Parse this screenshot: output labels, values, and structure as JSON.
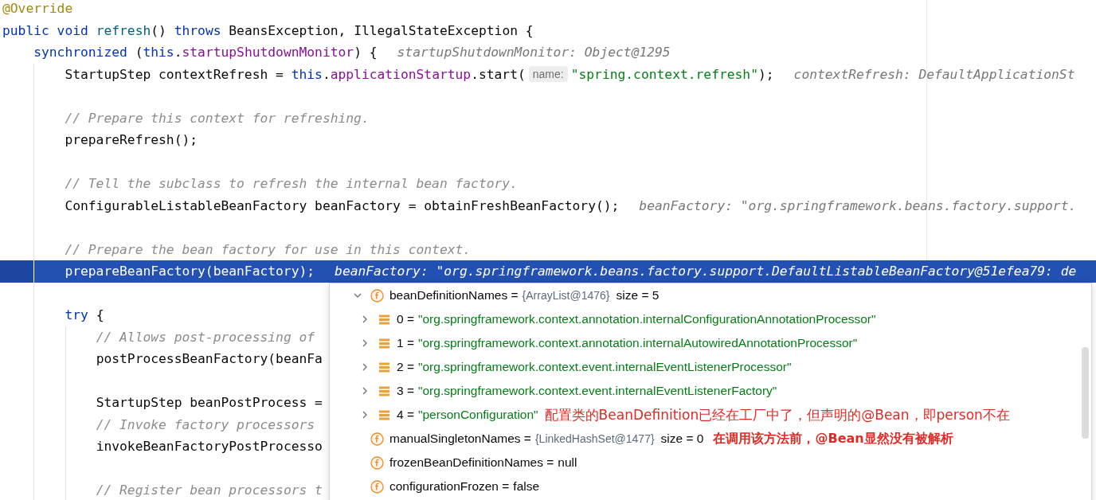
{
  "editor": {
    "lines": [
      {
        "kind": "code",
        "current": false,
        "tokens": [
          {
            "kind": "anno",
            "text": "@Override"
          }
        ]
      },
      {
        "kind": "code",
        "current": false,
        "tokens": [
          {
            "kind": "kw",
            "text": "public void "
          },
          {
            "kind": "decl",
            "text": "refresh"
          },
          {
            "kind": "plain",
            "text": "() "
          },
          {
            "kind": "kw",
            "text": "throws "
          },
          {
            "kind": "plain",
            "text": "BeansException, IllegalStateException {"
          }
        ],
        "children": [
          {
            "kind": "code",
            "current": false,
            "tokens": [
              {
                "kind": "kw",
                "text": "synchronized "
              },
              {
                "kind": "plain",
                "text": "("
              },
              {
                "kind": "kw",
                "text": "this"
              },
              {
                "kind": "plain",
                "text": "."
              },
              {
                "kind": "field",
                "text": "startupShutdownMonitor"
              },
              {
                "kind": "plain",
                "text": ") {"
              },
              {
                "kind": "value-hint",
                "text": "startupShutdownMonitor: Object@1295"
              }
            ],
            "children": [
              {
                "kind": "code",
                "current": false,
                "tokens": [
                  {
                    "kind": "plain",
                    "text": "StartupStep contextRefresh = "
                  },
                  {
                    "kind": "kw",
                    "text": "this"
                  },
                  {
                    "kind": "plain",
                    "text": "."
                  },
                  {
                    "kind": "field",
                    "text": "applicationStartup"
                  },
                  {
                    "kind": "plain",
                    "text": ".start("
                  },
                  {
                    "kind": "param-hint",
                    "text": "name:"
                  },
                  {
                    "kind": "str",
                    "text": "\"spring.context.refresh\""
                  },
                  {
                    "kind": "plain",
                    "text": ");"
                  },
                  {
                    "kind": "value-hint",
                    "text": "contextRefresh: DefaultApplicationSt"
                  }
                ]
              },
              {
                "kind": "blank",
                "current": false
              },
              {
                "kind": "code",
                "current": false,
                "tokens": [
                  {
                    "kind": "comment",
                    "text": "// Prepare this context for refreshing."
                  }
                ]
              },
              {
                "kind": "code",
                "current": false,
                "tokens": [
                  {
                    "kind": "plain",
                    "text": "prepareRefresh();"
                  }
                ]
              },
              {
                "kind": "blank",
                "current": false
              },
              {
                "kind": "code",
                "current": false,
                "tokens": [
                  {
                    "kind": "comment",
                    "text": "// Tell the subclass to refresh the internal bean factory."
                  }
                ]
              },
              {
                "kind": "code",
                "current": false,
                "tokens": [
                  {
                    "kind": "plain",
                    "text": "ConfigurableListableBeanFactory beanFactory = obtainFreshBeanFactory();"
                  },
                  {
                    "kind": "value-hint",
                    "text": "beanFactory: \"org.springframework.beans.factory.support."
                  }
                ]
              },
              {
                "kind": "blank",
                "current": false
              },
              {
                "kind": "code",
                "current": false,
                "tokens": [
                  {
                    "kind": "comment",
                    "text": "// Prepare the bean factory for use in this context."
                  }
                ]
              },
              {
                "kind": "code",
                "current": true,
                "tokens": [
                  {
                    "kind": "plain",
                    "text": "prepareBeanFactory(beanFactory);"
                  },
                  {
                    "kind": "value-hint",
                    "text": "beanFactory: \"org.springframework.beans.factory.support.DefaultListableBeanFactory@51efea79: de"
                  }
                ]
              },
              {
                "kind": "blank",
                "current": false
              },
              {
                "kind": "code",
                "current": false,
                "tokens": [
                  {
                    "kind": "kw",
                    "text": "try "
                  },
                  {
                    "kind": "plain",
                    "text": "{"
                  }
                ],
                "children": [
                  {
                    "kind": "code",
                    "current": false,
                    "tokens": [
                      {
                        "kind": "comment",
                        "text": "// Allows post-processing of"
                      }
                    ]
                  },
                  {
                    "kind": "code",
                    "current": false,
                    "tokens": [
                      {
                        "kind": "plain",
                        "text": "postProcessBeanFactory(beanFa"
                      }
                    ]
                  },
                  {
                    "kind": "blank",
                    "current": false
                  },
                  {
                    "kind": "code",
                    "current": false,
                    "tokens": [
                      {
                        "kind": "plain",
                        "text": "StartupStep beanPostProcess ="
                      }
                    ]
                  },
                  {
                    "kind": "code",
                    "current": false,
                    "tokens": [
                      {
                        "kind": "comment",
                        "text": "// Invoke factory processors"
                      }
                    ]
                  },
                  {
                    "kind": "code",
                    "current": false,
                    "tokens": [
                      {
                        "kind": "plain",
                        "text": "invokeBeanFactoryPostProcesso"
                      }
                    ]
                  },
                  {
                    "kind": "blank",
                    "current": false
                  },
                  {
                    "kind": "code",
                    "current": false,
                    "tokens": [
                      {
                        "kind": "comment",
                        "text": "// Register bean processors t"
                      }
                    ]
                  }
                ]
              }
            ]
          }
        ]
      }
    ]
  },
  "debug_popup": {
    "nodes": [
      {
        "kind": "field",
        "text": "beanDefinitionNames =",
        "value": {
          "kind": "object",
          "text": "{ArrayList@1476}"
        },
        "extra": "size = 5",
        "expanded": true,
        "children": [
          {
            "kind": "element",
            "text": "0 =",
            "value": {
              "kind": "string",
              "text": "\"org.springframework.context.annotation.internalConfigurationAnnotationProcessor\""
            },
            "expanded": false
          },
          {
            "kind": "element",
            "text": "1 =",
            "value": {
              "kind": "string",
              "text": "\"org.springframework.context.annotation.internalAutowiredAnnotationProcessor\""
            },
            "expanded": false
          },
          {
            "kind": "element",
            "text": "2 =",
            "value": {
              "kind": "string",
              "text": "\"org.springframework.context.event.internalEventListenerProcessor\""
            },
            "expanded": false
          },
          {
            "kind": "element",
            "text": "3 =",
            "value": {
              "kind": "string",
              "text": "\"org.springframework.context.event.internalEventListenerFactory\""
            },
            "expanded": false
          },
          {
            "kind": "element",
            "text": "4 =",
            "value": {
              "kind": "string",
              "text": "\"personConfiguration\""
            },
            "expanded": false,
            "note": {
              "text": "配置类的BeanDefinition已经在工厂中了，但声明的@Bean，即person不在",
              "bold": false
            }
          }
        ]
      },
      {
        "kind": "field",
        "text": "manualSingletonNames =",
        "value": {
          "kind": "object",
          "text": "{LinkedHashSet@1477}"
        },
        "extra": "size = 0",
        "note": {
          "text": "在调用该方法前，@Bean显然没有被解析",
          "bold": true
        }
      },
      {
        "kind": "field",
        "text": "frozenBeanDefinitionNames =",
        "value": {
          "kind": "literal",
          "text": "null"
        }
      },
      {
        "kind": "field",
        "text": "configurationFrozen =",
        "value": {
          "kind": "literal",
          "text": "false"
        }
      }
    ]
  }
}
